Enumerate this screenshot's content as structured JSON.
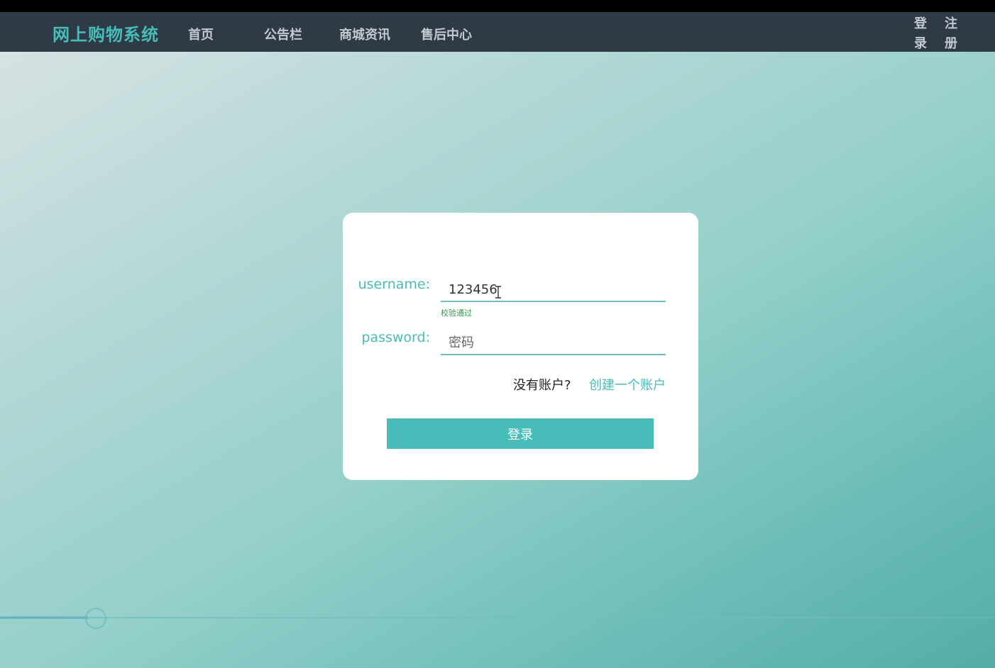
{
  "navbar": {
    "brand": "网上购物系统",
    "items": [
      {
        "label": "首页"
      },
      {
        "label": "公告栏"
      },
      {
        "label": "商城资讯"
      },
      {
        "label": "售后中心"
      }
    ],
    "login": "登录",
    "register": "注册"
  },
  "form": {
    "username_label": "username:",
    "username_value": "123456",
    "username_hint": "校验通过",
    "password_label": "password:",
    "password_placeholder": "密码",
    "no_account_text": "没有账户?",
    "create_account_link": "创建一个账户",
    "login_button": "登录"
  },
  "colors": {
    "accent": "#47bcb8",
    "navbar": "#2f3a47",
    "hint_ok": "#2f9a48"
  }
}
